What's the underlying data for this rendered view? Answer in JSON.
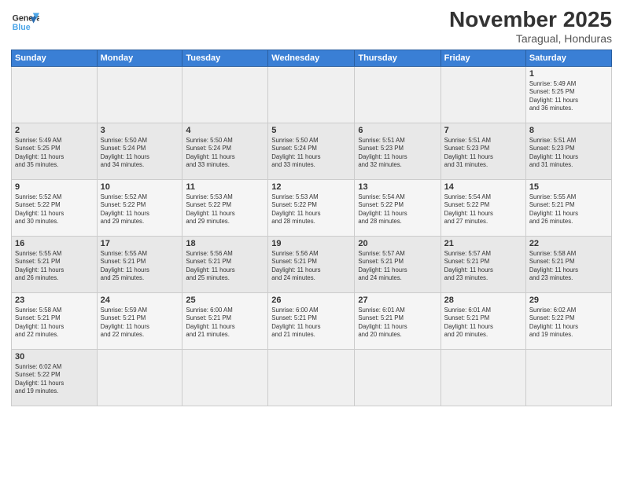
{
  "header": {
    "logo_general": "General",
    "logo_blue": "Blue",
    "month": "November 2025",
    "location": "Taragual, Honduras"
  },
  "days_of_week": [
    "Sunday",
    "Monday",
    "Tuesday",
    "Wednesday",
    "Thursday",
    "Friday",
    "Saturday"
  ],
  "weeks": [
    [
      {
        "day": "",
        "info": ""
      },
      {
        "day": "",
        "info": ""
      },
      {
        "day": "",
        "info": ""
      },
      {
        "day": "",
        "info": ""
      },
      {
        "day": "",
        "info": ""
      },
      {
        "day": "",
        "info": ""
      },
      {
        "day": "1",
        "info": "Sunrise: 5:49 AM\nSunset: 5:25 PM\nDaylight: 11 hours\nand 36 minutes."
      }
    ],
    [
      {
        "day": "2",
        "info": "Sunrise: 5:49 AM\nSunset: 5:25 PM\nDaylight: 11 hours\nand 35 minutes."
      },
      {
        "day": "3",
        "info": "Sunrise: 5:50 AM\nSunset: 5:24 PM\nDaylight: 11 hours\nand 34 minutes."
      },
      {
        "day": "4",
        "info": "Sunrise: 5:50 AM\nSunset: 5:24 PM\nDaylight: 11 hours\nand 33 minutes."
      },
      {
        "day": "5",
        "info": "Sunrise: 5:50 AM\nSunset: 5:24 PM\nDaylight: 11 hours\nand 33 minutes."
      },
      {
        "day": "6",
        "info": "Sunrise: 5:51 AM\nSunset: 5:23 PM\nDaylight: 11 hours\nand 32 minutes."
      },
      {
        "day": "7",
        "info": "Sunrise: 5:51 AM\nSunset: 5:23 PM\nDaylight: 11 hours\nand 31 minutes."
      },
      {
        "day": "8",
        "info": "Sunrise: 5:51 AM\nSunset: 5:23 PM\nDaylight: 11 hours\nand 31 minutes."
      }
    ],
    [
      {
        "day": "9",
        "info": "Sunrise: 5:52 AM\nSunset: 5:22 PM\nDaylight: 11 hours\nand 30 minutes."
      },
      {
        "day": "10",
        "info": "Sunrise: 5:52 AM\nSunset: 5:22 PM\nDaylight: 11 hours\nand 29 minutes."
      },
      {
        "day": "11",
        "info": "Sunrise: 5:53 AM\nSunset: 5:22 PM\nDaylight: 11 hours\nand 29 minutes."
      },
      {
        "day": "12",
        "info": "Sunrise: 5:53 AM\nSunset: 5:22 PM\nDaylight: 11 hours\nand 28 minutes."
      },
      {
        "day": "13",
        "info": "Sunrise: 5:54 AM\nSunset: 5:22 PM\nDaylight: 11 hours\nand 28 minutes."
      },
      {
        "day": "14",
        "info": "Sunrise: 5:54 AM\nSunset: 5:22 PM\nDaylight: 11 hours\nand 27 minutes."
      },
      {
        "day": "15",
        "info": "Sunrise: 5:55 AM\nSunset: 5:21 PM\nDaylight: 11 hours\nand 26 minutes."
      }
    ],
    [
      {
        "day": "16",
        "info": "Sunrise: 5:55 AM\nSunset: 5:21 PM\nDaylight: 11 hours\nand 26 minutes."
      },
      {
        "day": "17",
        "info": "Sunrise: 5:55 AM\nSunset: 5:21 PM\nDaylight: 11 hours\nand 25 minutes."
      },
      {
        "day": "18",
        "info": "Sunrise: 5:56 AM\nSunset: 5:21 PM\nDaylight: 11 hours\nand 25 minutes."
      },
      {
        "day": "19",
        "info": "Sunrise: 5:56 AM\nSunset: 5:21 PM\nDaylight: 11 hours\nand 24 minutes."
      },
      {
        "day": "20",
        "info": "Sunrise: 5:57 AM\nSunset: 5:21 PM\nDaylight: 11 hours\nand 24 minutes."
      },
      {
        "day": "21",
        "info": "Sunrise: 5:57 AM\nSunset: 5:21 PM\nDaylight: 11 hours\nand 23 minutes."
      },
      {
        "day": "22",
        "info": "Sunrise: 5:58 AM\nSunset: 5:21 PM\nDaylight: 11 hours\nand 23 minutes."
      }
    ],
    [
      {
        "day": "23",
        "info": "Sunrise: 5:58 AM\nSunset: 5:21 PM\nDaylight: 11 hours\nand 22 minutes."
      },
      {
        "day": "24",
        "info": "Sunrise: 5:59 AM\nSunset: 5:21 PM\nDaylight: 11 hours\nand 22 minutes."
      },
      {
        "day": "25",
        "info": "Sunrise: 6:00 AM\nSunset: 5:21 PM\nDaylight: 11 hours\nand 21 minutes."
      },
      {
        "day": "26",
        "info": "Sunrise: 6:00 AM\nSunset: 5:21 PM\nDaylight: 11 hours\nand 21 minutes."
      },
      {
        "day": "27",
        "info": "Sunrise: 6:01 AM\nSunset: 5:21 PM\nDaylight: 11 hours\nand 20 minutes."
      },
      {
        "day": "28",
        "info": "Sunrise: 6:01 AM\nSunset: 5:21 PM\nDaylight: 11 hours\nand 20 minutes."
      },
      {
        "day": "29",
        "info": "Sunrise: 6:02 AM\nSunset: 5:22 PM\nDaylight: 11 hours\nand 19 minutes."
      }
    ],
    [
      {
        "day": "30",
        "info": "Sunrise: 6:02 AM\nSunset: 5:22 PM\nDaylight: 11 hours\nand 19 minutes."
      },
      {
        "day": "",
        "info": ""
      },
      {
        "day": "",
        "info": ""
      },
      {
        "day": "",
        "info": ""
      },
      {
        "day": "",
        "info": ""
      },
      {
        "day": "",
        "info": ""
      },
      {
        "day": "",
        "info": ""
      }
    ]
  ]
}
